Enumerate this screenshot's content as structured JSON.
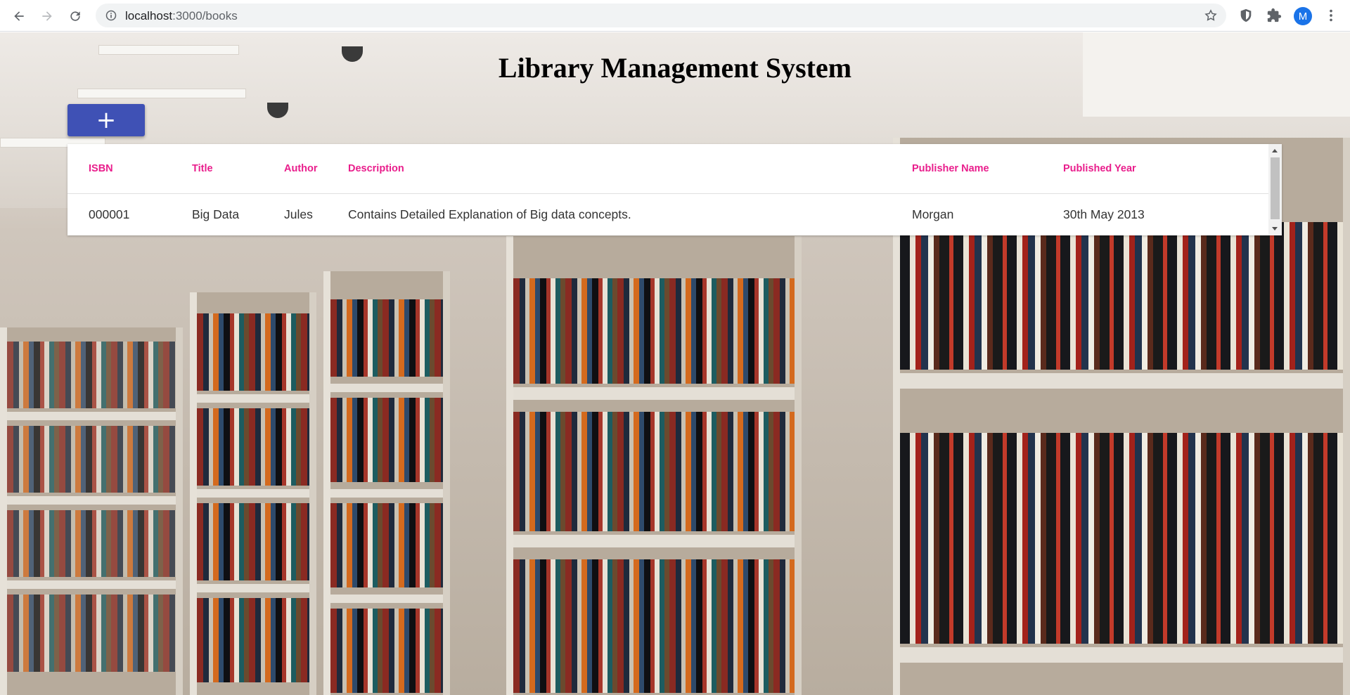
{
  "browser": {
    "url_host": "localhost",
    "url_path": ":3000/books",
    "avatar_letter": "M",
    "icons": [
      "back-arrow-icon",
      "forward-arrow-icon",
      "reload-icon",
      "info-icon",
      "star-icon",
      "shield-extension-icon",
      "puzzle-extension-icon",
      "kebab-menu-icon"
    ]
  },
  "page": {
    "title": "Library Management System",
    "add_button_label": "+"
  },
  "table": {
    "columns": [
      "ISBN",
      "Title",
      "Author",
      "Description",
      "Publisher Name",
      "Published Year"
    ],
    "rows": [
      {
        "isbn": "000001",
        "title": "Big Data",
        "author": "Jules",
        "description": "Contains Detailed Explanation of Big data concepts.",
        "publisher": "Morgan",
        "year": "30th May 2013"
      }
    ]
  },
  "colors": {
    "header_text": "#e91e8c",
    "add_button": "#3f51b5",
    "avatar": "#1a73e8"
  }
}
